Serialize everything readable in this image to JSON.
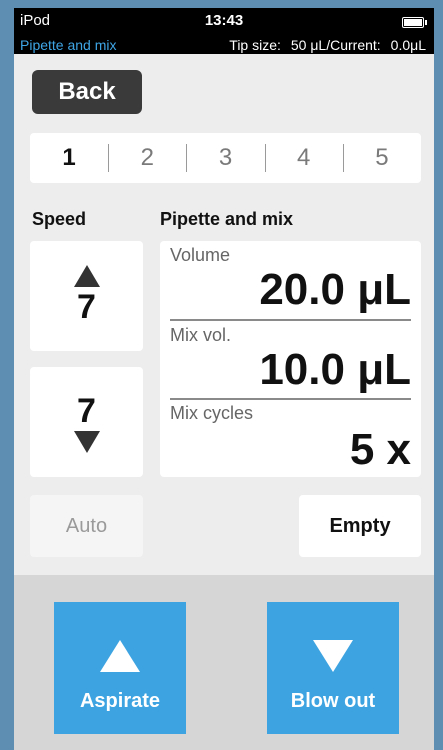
{
  "status_bar": {
    "carrier": "iPod",
    "time": "13:43",
    "mode": "Pipette and mix",
    "tip_size_label": "Tip size:",
    "tip_size_value": "50 μL/Current:",
    "current_value": "0.0μL"
  },
  "back_label": "Back",
  "steps": [
    "1",
    "2",
    "3",
    "4",
    "5"
  ],
  "speed": {
    "label": "Speed",
    "aspirate_speed": "7",
    "dispense_speed": "7"
  },
  "params": {
    "label": "Pipette and mix",
    "volume_label": "Volume",
    "volume_value": "20.0 μL",
    "mix_vol_label": "Mix vol.",
    "mix_vol_value": "10.0 μL",
    "mix_cycles_label": "Mix cycles",
    "mix_cycles_value": "5 x"
  },
  "auto_label": "Auto",
  "empty_label": "Empty",
  "actions": {
    "aspirate_label": "Aspirate",
    "blow_out_label": "Blow out"
  }
}
